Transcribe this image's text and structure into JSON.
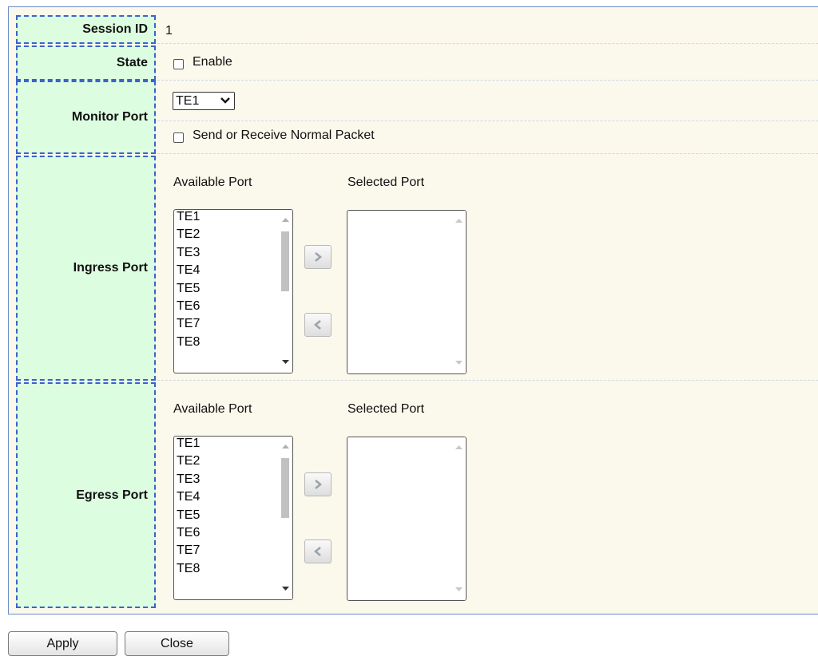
{
  "session": {
    "label": "Session ID",
    "value": "1"
  },
  "state": {
    "label": "State",
    "option_label": "Enable",
    "checked": false
  },
  "monitor": {
    "label": "Monitor Port",
    "selected_port": "TE1",
    "option_label": "Send or Receive Normal Packet",
    "checked": false
  },
  "ingress": {
    "label": "Ingress Port",
    "available_header": "Available Port",
    "selected_header": "Selected Port",
    "available_ports": [
      "TE1",
      "TE2",
      "TE3",
      "TE4",
      "TE5",
      "TE6",
      "TE7",
      "TE8"
    ],
    "selected_ports": []
  },
  "egress": {
    "label": "Egress Port",
    "available_header": "Available Port",
    "selected_header": "Selected Port",
    "available_ports": [
      "TE1",
      "TE2",
      "TE3",
      "TE4",
      "TE5",
      "TE6",
      "TE7",
      "TE8"
    ],
    "selected_ports": []
  },
  "buttons": {
    "apply": "Apply",
    "close": "Close"
  }
}
